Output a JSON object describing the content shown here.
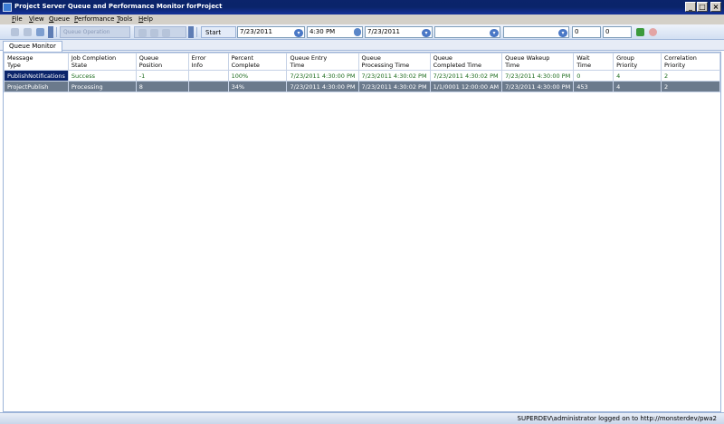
{
  "window": {
    "title": "Project Server Queue and Performance Monitor forProject",
    "controls": {
      "minimize": "_",
      "maximize": "□",
      "close": "×"
    }
  },
  "menu": [
    "File",
    "View",
    "Queue",
    "Performance",
    "Tools",
    "Help"
  ],
  "toolbar": {
    "disabled_combo_text": "Queue Operation",
    "start_date_label": "Start Date",
    "start_date": "7/23/2011",
    "start_time": "4:30 PM",
    "end_date": "7/23/2011",
    "filter_a": "",
    "filter_b": "",
    "number_a": "0",
    "number_b": "0",
    "dropdown_glyph": "▾"
  },
  "tabs": [
    {
      "label": "Queue Monitor"
    }
  ],
  "grid": {
    "headers": [
      [
        "Message",
        "Type"
      ],
      [
        "Job Completion",
        "State"
      ],
      [
        "Queue",
        "Position"
      ],
      [
        "Error",
        "Info"
      ],
      [
        "Percent",
        "Complete"
      ],
      [
        "Queue Entry",
        "Time"
      ],
      [
        "Queue",
        "Processing Time"
      ],
      [
        "Queue",
        "Completed Time"
      ],
      [
        "Queue Wakeup",
        "Time"
      ],
      [
        "Wait",
        "Time"
      ],
      [
        "Group",
        "Priority"
      ],
      [
        "Correlation",
        "Priority"
      ]
    ],
    "rows": [
      [
        "PublishNotifications",
        "Success",
        "-1",
        "",
        "100%",
        "7/23/2011 4:30:00 PM",
        "7/23/2011 4:30:02 PM",
        "7/23/2011 4:30:02 PM",
        "7/23/2011 4:30:00 PM",
        "0",
        "4",
        "2"
      ],
      [
        "ProjectPublish",
        "Processing",
        "8",
        "",
        "34%",
        "7/23/2011 4:30:00 PM",
        "7/23/2011 4:30:02 PM",
        "1/1/0001 12:00:00 AM",
        "7/23/2011 4:30:00 PM",
        "453",
        "4",
        "2"
      ]
    ]
  },
  "status": {
    "text": "SUPERDEV\\administrator logged on to http://monsterdev/pwa2"
  },
  "colors": {
    "titlebar": "#0a246a",
    "selected_cell": "#0a246a",
    "success_text": "#1c6b1c",
    "processing_row": "#6b7a8c"
  }
}
